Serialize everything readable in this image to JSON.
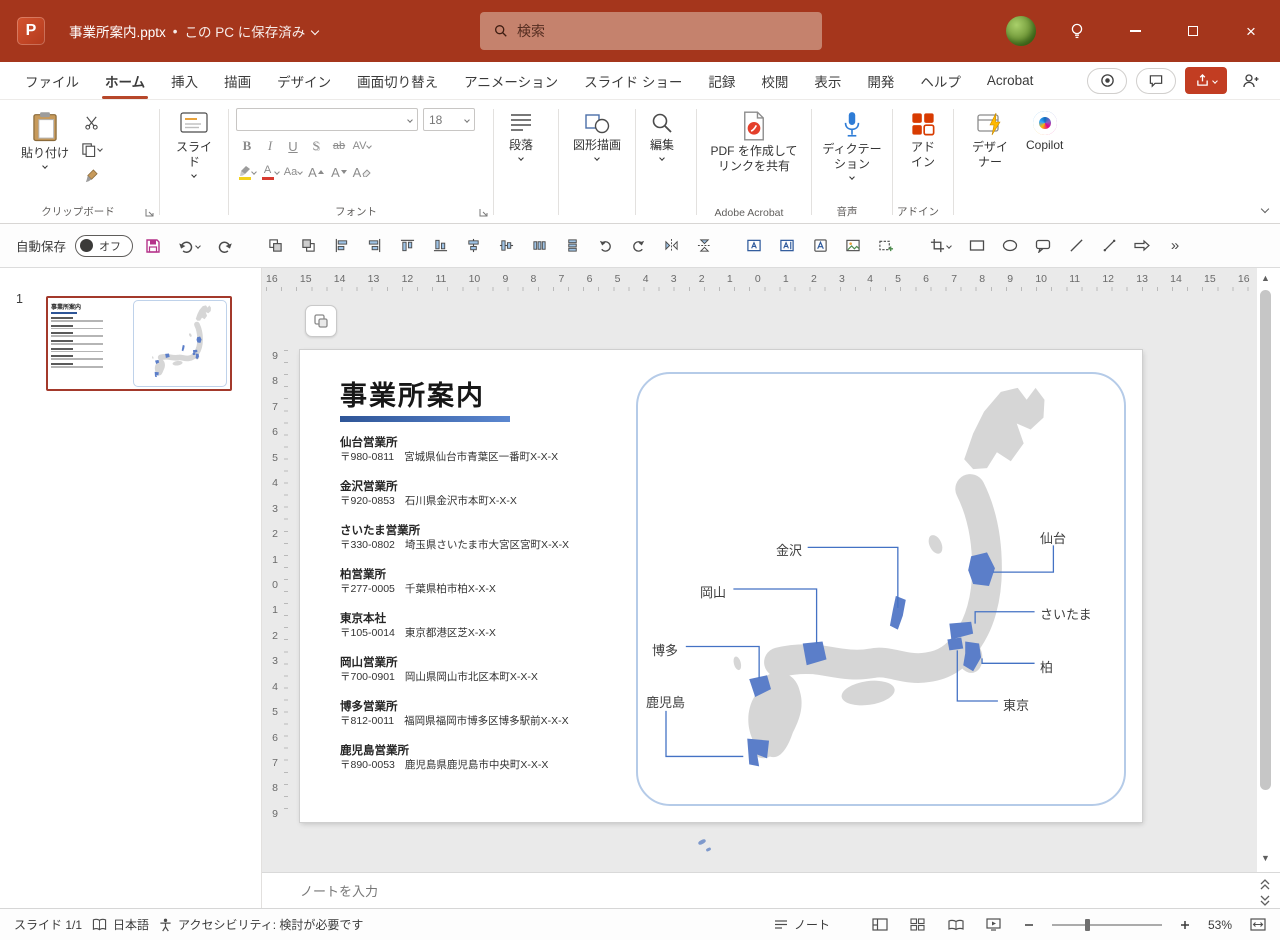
{
  "window": {
    "file_name": "事業所案内.pptx",
    "save_separator": "•",
    "save_status": "この PC に保存済み",
    "search_label": "検索"
  },
  "ribbon_tabs": {
    "file": "ファイル",
    "home": "ホーム",
    "insert": "挿入",
    "draw": "描画",
    "design": "デザイン",
    "transitions": "画面切り替え",
    "animations": "アニメーション",
    "slideshow": "スライド ショー",
    "record": "記録",
    "review": "校閲",
    "view": "表示",
    "developer": "開発",
    "help": "ヘルプ",
    "acrobat": "Acrobat"
  },
  "ribbon": {
    "paste_label": "貼り付け",
    "slide_label": "スライド",
    "clipboard_group": "クリップボード",
    "font_group": "フォント",
    "font_size": "18",
    "bold": "B",
    "italic": "I",
    "underline": "U",
    "shadow": "S",
    "strikethrough": "ab",
    "spacing": "AV",
    "change_case": "Aa",
    "grow_font": "A",
    "shrink_font": "A",
    "clear_format": "A",
    "paragraph_label": "段落",
    "drawing_label": "図形描画",
    "editing_label": "編集",
    "acrobat_button": "PDF を作成してリンクを共有",
    "acrobat_group": "Adobe Acrobat",
    "dictation_label": "ディクテーション",
    "voice_group": "音声",
    "addins_button": "アドイン",
    "addins_group": "アドイン",
    "designer_label": "デザイナー",
    "copilot_label": "Copilot"
  },
  "quick_access": {
    "autosave_label": "自動保存",
    "autosave_state": "オフ"
  },
  "slides_panel": {
    "slide_number": "1"
  },
  "rulers": {
    "horizontal": [
      "16",
      "15",
      "14",
      "13",
      "12",
      "11",
      "10",
      "9",
      "8",
      "7",
      "6",
      "5",
      "4",
      "3",
      "2",
      "1",
      "0",
      "1",
      "2",
      "3",
      "4",
      "5",
      "6",
      "7",
      "8",
      "9",
      "10",
      "11",
      "12",
      "13",
      "14",
      "15",
      "16"
    ],
    "vertical": [
      "9",
      "8",
      "7",
      "6",
      "5",
      "4",
      "3",
      "2",
      "1",
      "0",
      "1",
      "2",
      "3",
      "4",
      "5",
      "6",
      "7",
      "8",
      "9"
    ]
  },
  "slide": {
    "title": "事業所案内",
    "offices": [
      {
        "name": "仙台営業所",
        "zip": "〒980-0811",
        "address": "宮城県仙台市青葉区一番町X-X-X"
      },
      {
        "name": "金沢営業所",
        "zip": "〒920-0853",
        "address": "石川県金沢市本町X-X-X"
      },
      {
        "name": "さいたま営業所",
        "zip": "〒330-0802",
        "address": "埼玉県さいたま市大宮区宮町X-X-X"
      },
      {
        "name": "柏営業所",
        "zip": "〒277-0005",
        "address": "千葉県柏市柏X-X-X"
      },
      {
        "name": "東京本社",
        "zip": "〒105-0014",
        "address": "東京都港区芝X-X-X"
      },
      {
        "name": "岡山営業所",
        "zip": "〒700-0901",
        "address": "岡山県岡山市北区本町X-X-X"
      },
      {
        "name": "博多営業所",
        "zip": "〒812-0011",
        "address": "福岡県福岡市博多区博多駅前X-X-X"
      },
      {
        "name": "鹿児島営業所",
        "zip": "〒890-0053",
        "address": "鹿児島県鹿児島市中央町X-X-X"
      }
    ],
    "map_labels": {
      "kanazawa": "金沢",
      "okayama": "岡山",
      "hakata": "博多",
      "kagoshima": "鹿児島",
      "sendai": "仙台",
      "saitama": "さいたま",
      "kashiwa": "柏",
      "tokyo": "東京"
    }
  },
  "notes": {
    "placeholder": "ノートを入力"
  },
  "status_bar": {
    "slide_indicator": "スライド 1/1",
    "language": "日本語",
    "accessibility": "アクセシビリティ: 検討が必要です",
    "notes_button": "ノート",
    "zoom_level": "53%"
  },
  "colors": {
    "titlebar": "#A5361C",
    "accent": "#B7472A",
    "map_base": "#D6D6D6",
    "map_highlight": "#5B7EC9",
    "leader_line": "#4472C4",
    "title_underline": "#2E5597"
  }
}
